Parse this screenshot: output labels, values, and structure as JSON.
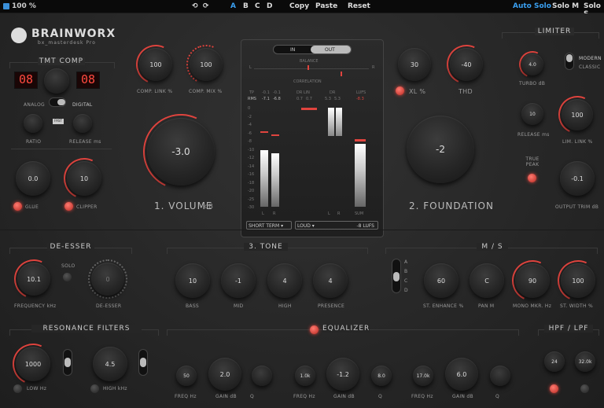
{
  "topbar": {
    "zoom": "100 %",
    "undo": "⟲",
    "redo": "⟳",
    "slots": [
      "A",
      "B",
      "C",
      "D"
    ],
    "copy": "Copy",
    "paste": "Paste",
    "reset": "Reset",
    "auto_solo": "Auto Solo",
    "solo_m": "Solo M",
    "solo_s": "Solo S"
  },
  "brand": {
    "name": "BRAINWORX",
    "sub": "bx_masterdesk Pro"
  },
  "tmt": {
    "title": "TMT COMP",
    "left": "08",
    "right": "08",
    "analog": "ANALOG",
    "digital": "DIGITAL",
    "ratio": "RATIO",
    "fast": "FAST",
    "release": "RELEASE ms"
  },
  "glue": {
    "value": "0.0",
    "label": "GLUE"
  },
  "clipper": {
    "value": "10",
    "label": "CLIPPER"
  },
  "comp_link": {
    "value": "100",
    "label": "COMP. LINK %"
  },
  "comp_mix": {
    "value": "100",
    "label": "COMP. MIX %"
  },
  "volume": {
    "value": "-3.0",
    "label": "1. VOLUME",
    "unit": "dB"
  },
  "meter": {
    "in": "IN",
    "out": "OUT",
    "balance": "BALANCE",
    "correlation": "CORRELATION",
    "l": "L",
    "r": "R",
    "tp": "TP",
    "rms": "RMS",
    "tp1": "-0.1",
    "tp2": "-0.1",
    "rms1": "-7.1",
    "rms2": "-6.8",
    "dr_lin": "DR LIN",
    "dr": "DR",
    "lufs": "LUFS",
    "dr1": "0.7",
    "dr2": "0.7",
    "drv1": "5.3",
    "drv2": "5.3",
    "lufs_v": "-8.3",
    "sum": "SUM",
    "short_term": "SHORT TERM",
    "loud": "LOUD",
    "lufs_sel": "-8 LUFS",
    "scale": [
      "0",
      "-2",
      "-4",
      "-6",
      "-8",
      "-10",
      "-12",
      "-14",
      "-16",
      "-18",
      "-20",
      "-25",
      "-30"
    ]
  },
  "xl": {
    "value": "30",
    "label": "XL %"
  },
  "thd": {
    "value": "-40",
    "label": "THD"
  },
  "foundation": {
    "value": "-2",
    "label": "2. FOUNDATION"
  },
  "limiter": {
    "title": "LIMITER",
    "turbo": "4.0",
    "turbo_label": "TURBO dB",
    "modern": "MODERN",
    "classic": "CLASSIC",
    "release": "10",
    "release_label": "RELEASE ms",
    "lim_link": "100",
    "lim_link_label": "LIM. LINK %",
    "true_peak": "TRUE PEAK",
    "out_trim": "-0.1",
    "out_trim_label": "OUTPUT TRIM dB"
  },
  "deesser": {
    "title": "DE-ESSER",
    "freq": "10.1",
    "freq_label": "FREQUENCY kHz",
    "solo": "SOLO",
    "amount": "0",
    "amount_label": "DE-ESSER"
  },
  "tone": {
    "title": "3. TONE",
    "bass": "10",
    "bass_label": "BASS",
    "mid": "-1",
    "mid_label": "MID",
    "high": "4",
    "high_label": "HIGH",
    "presence": "4",
    "presence_label": "PRESENCE"
  },
  "ms": {
    "title": "M / S",
    "modes": [
      "A",
      "B",
      "C",
      "D"
    ],
    "enhance": "60",
    "enhance_label": "ST. ENHANCE %",
    "pan": "C",
    "pan_label": "PAN M",
    "mono": "90",
    "mono_label": "MONO MKR. Hz",
    "width": "100",
    "width_label": "ST. WIDTH %"
  },
  "resonance": {
    "title": "RESONANCE FILTERS",
    "low": "1000",
    "low_label": "LOW Hz",
    "high": "4.5",
    "high_label": "HIGH kHz"
  },
  "eq": {
    "title": "EQUALIZER",
    "b1_freq": "50",
    "b1_gain": "2.0",
    "b2_freq": "1.0k",
    "b2_gain": "-1.2",
    "b2_q": "8.0",
    "b3_freq": "17.0k",
    "b3_gain": "6.0",
    "freq_label": "FREQ Hz",
    "gain_label": "GAIN dB",
    "q_label": "Q"
  },
  "hpf": {
    "title": "HPF / LPF",
    "hp": "24",
    "lp": "32.0k"
  }
}
